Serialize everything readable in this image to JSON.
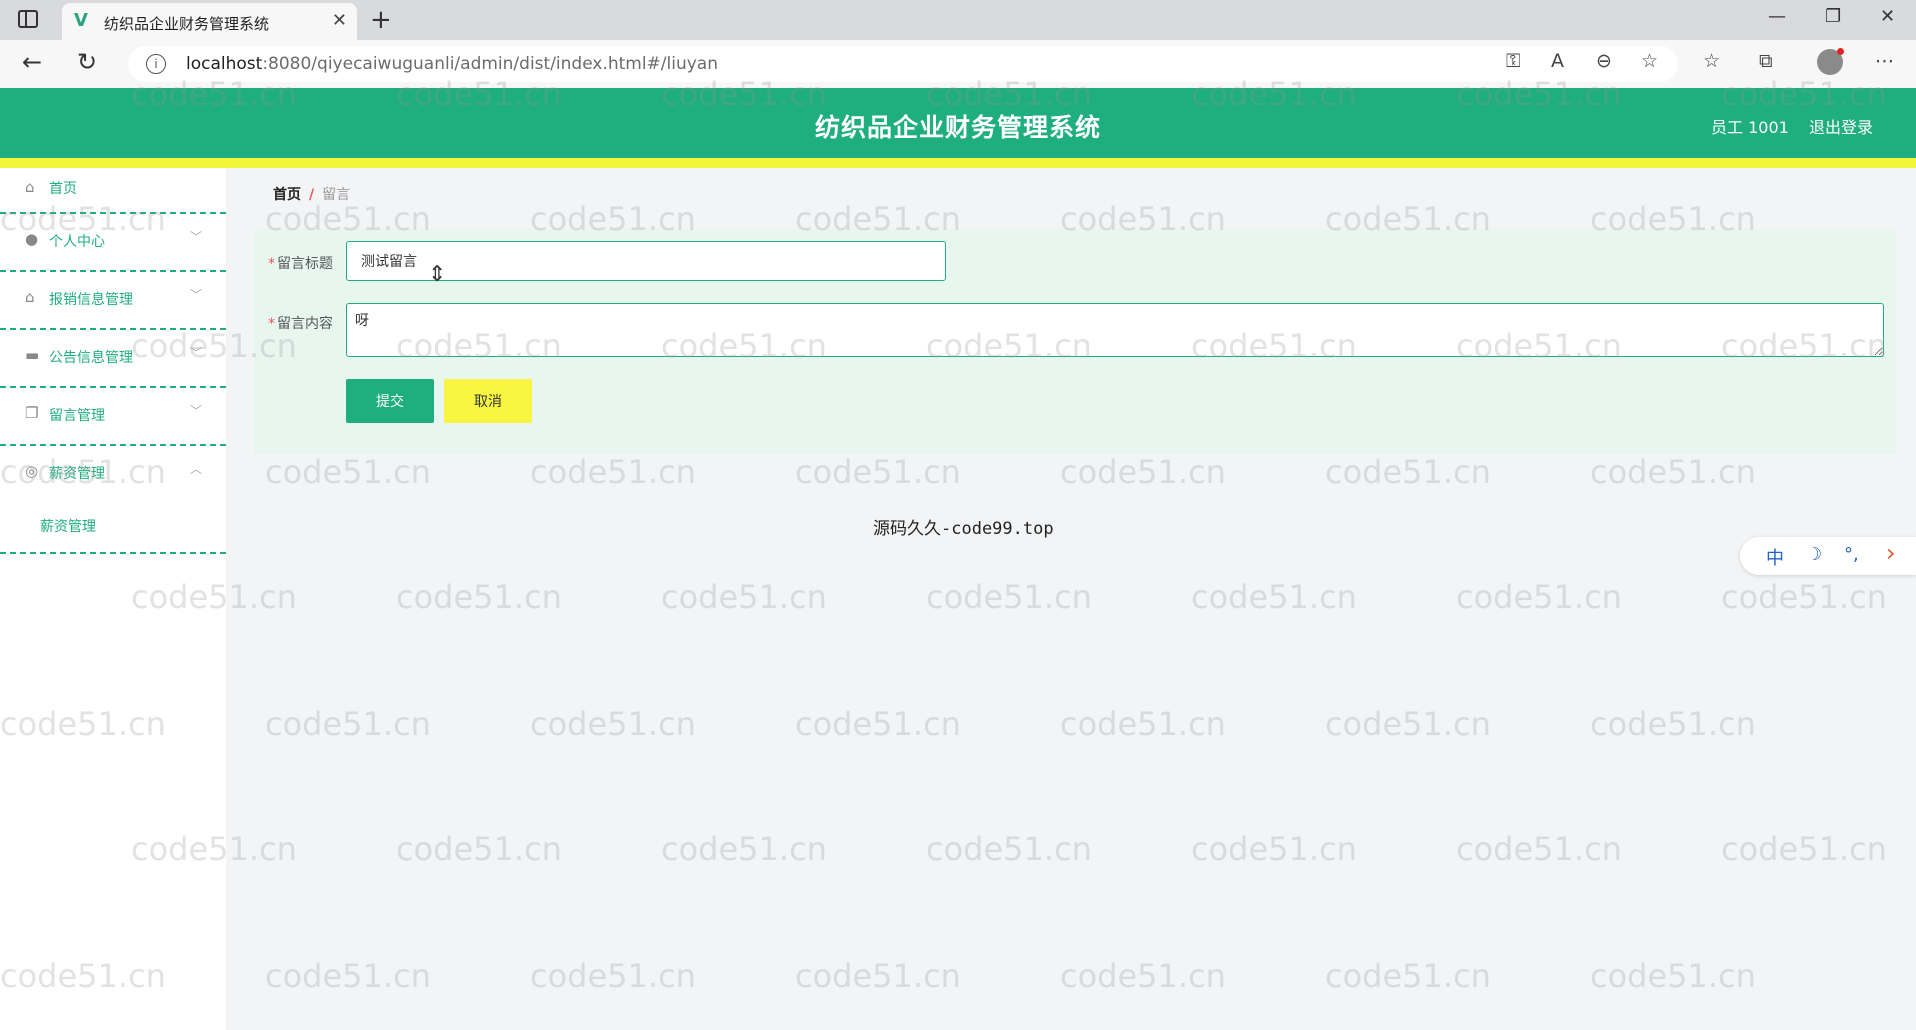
{
  "browser": {
    "tab_title": "纺织品企业财务管理系统",
    "tab_favicon": "V",
    "url_host": "localhost",
    "url_rest": ":8080/qiyecaiwuguanli/admin/dist/index.html#/liuyan"
  },
  "header": {
    "title": "纺织品企业财务管理系统",
    "user": "员工 1001",
    "logout": "退出登录"
  },
  "sidebar": {
    "items": [
      {
        "label": "首页",
        "icon": "home-icon"
      },
      {
        "label": "个人中心",
        "icon": "user-icon"
      },
      {
        "label": "报销信息管理",
        "icon": "bell-icon"
      },
      {
        "label": "公告信息管理",
        "icon": "monitor-icon"
      },
      {
        "label": "留言管理",
        "icon": "copy-icon"
      },
      {
        "label": "薪资管理",
        "icon": "circle-icon"
      }
    ],
    "submenu": "薪资管理"
  },
  "breadcrumb": {
    "home": "首页",
    "separator": "/",
    "current": "留言"
  },
  "form": {
    "title_label": "留言标题",
    "title_value": "测试留言",
    "content_label": "留言内容",
    "content_value": "呀",
    "submit_label": "提交",
    "cancel_label": "取消"
  },
  "footer": "源码久久-code99.top",
  "ime": {
    "lang": "中",
    "moon": "☽",
    "punct": "°,",
    "arrow": "›"
  },
  "watermark_text": "code51.cn",
  "colors": {
    "primary": "#1fae7d",
    "accent": "#f1f63b",
    "panel": "#e7f7f0"
  }
}
